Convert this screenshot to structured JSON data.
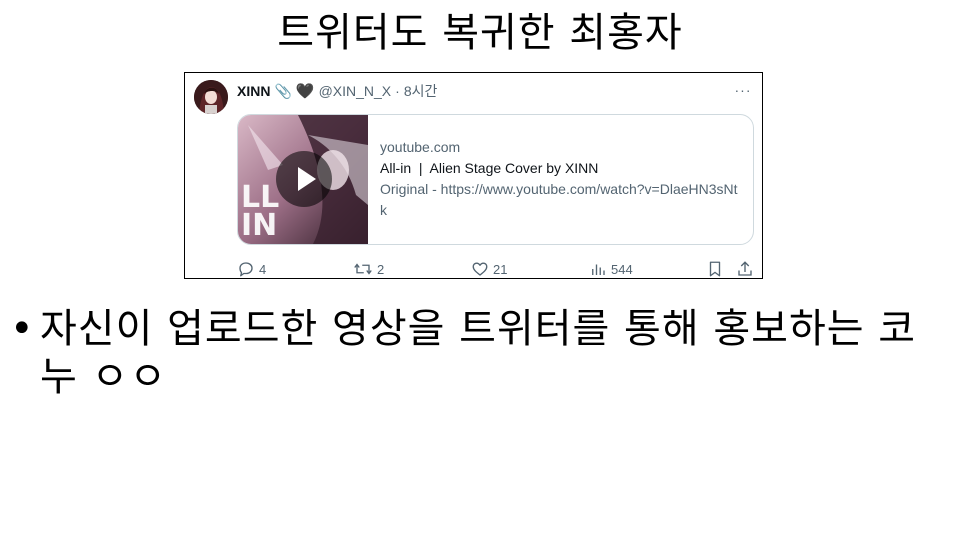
{
  "slide": {
    "title": "트위터도 복귀한 최홍자",
    "bullet": "•",
    "bullet_text": "자신이 업로드한 영상을 트위터를 통해 홍보하는 코누 ㅇㅇ"
  },
  "tweet": {
    "display_name": "XINN",
    "badge_clip": "📎",
    "badge_heart": "🖤",
    "handle": "@XIN_N_X",
    "separator": "·",
    "time": "8시간",
    "more_icon": "···",
    "card": {
      "domain": "youtube.com",
      "title": "All-in  |  Alien Stage Cover by XINN",
      "description": "Original - https://www.youtube.com/watch?v=DlaeHN3sNtk",
      "thumb_text": "LL IN"
    },
    "actions": {
      "replies": "4",
      "retweets": "2",
      "likes": "21",
      "views": "544"
    }
  },
  "colors": {
    "muted": "#536471",
    "text": "#0f1419",
    "card_border": "#cfd9de",
    "thumb_bg": "#c9a3b6"
  }
}
